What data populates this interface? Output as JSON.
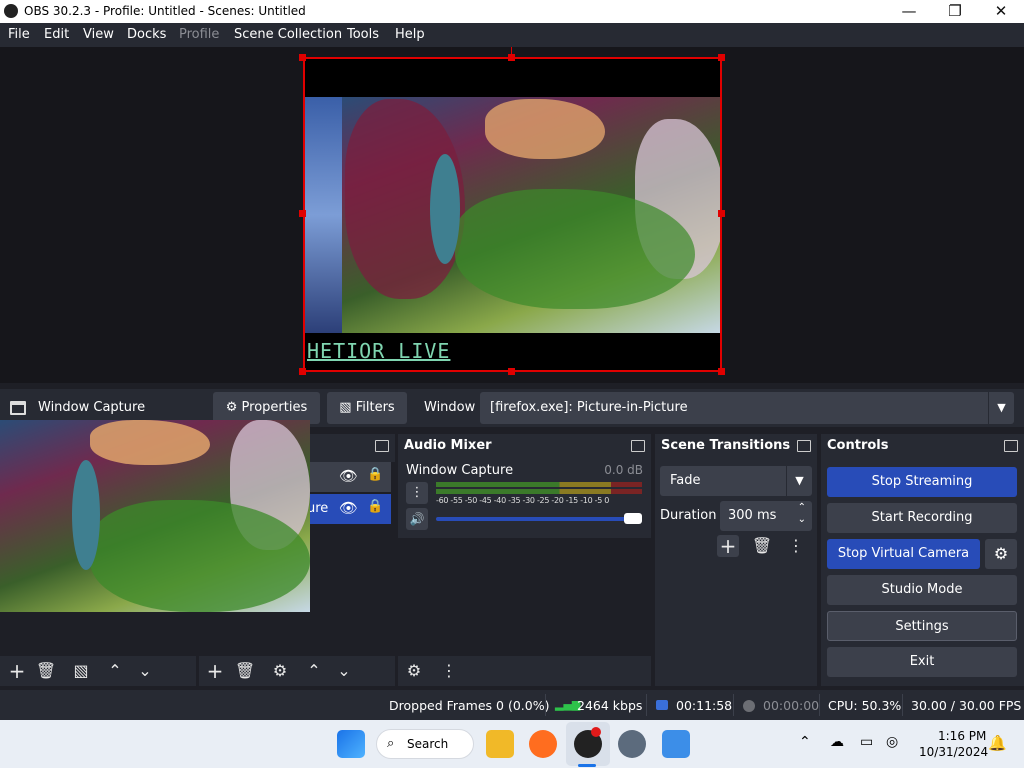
{
  "window": {
    "title": "OBS 30.2.3 - Profile: Untitled - Scenes: Untitled",
    "minimize": "—",
    "maximize": "❐",
    "close": "✕"
  },
  "menu": [
    "File",
    "Edit",
    "View",
    "Docks",
    "Profile",
    "Scene Collection",
    "Tools",
    "Help"
  ],
  "preview": {
    "overlay_text": "HETIOR LIVE"
  },
  "source_toolbar": {
    "source_name": "Window Capture",
    "properties_label": "Properties",
    "filters_label": "Filters",
    "window_label": "Window",
    "window_value": "[firefox.exe]: Picture-in-Picture"
  },
  "sources": {
    "items": [
      "ure"
    ]
  },
  "audio_mixer": {
    "title": "Audio Mixer",
    "channel_name": "Window Capture",
    "channel_db": "0.0 dB",
    "meter_ticks": [
      "-60",
      "-55",
      "-50",
      "-45",
      "-40",
      "-35",
      "-30",
      "-25",
      "-20",
      "-15",
      "-10",
      "-5",
      "0"
    ]
  },
  "transitions": {
    "title": "Scene Transitions",
    "selected": "Fade",
    "duration_label": "Duration",
    "duration_value": "300 ms"
  },
  "controls": {
    "title": "Controls",
    "stop_streaming": "Stop Streaming",
    "start_recording": "Start Recording",
    "stop_virtual_camera": "Stop Virtual Camera",
    "studio_mode": "Studio Mode",
    "settings": "Settings",
    "exit": "Exit"
  },
  "status": {
    "dropped_frames": "Dropped Frames 0 (0.0%)",
    "bitrate": "2464 kbps",
    "stream_time": "00:11:58",
    "record_time": "00:00:00",
    "cpu": "CPU: 50.3%",
    "fps": "30.00 / 30.00 FPS"
  },
  "taskbar": {
    "search_label": "Search",
    "time": "1:16 PM",
    "date": "10/31/2024"
  },
  "colors": {
    "accent": "#284cb8",
    "selection_red": "#e00000",
    "panel": "#272a33",
    "panel_dark": "#1e1f26"
  }
}
